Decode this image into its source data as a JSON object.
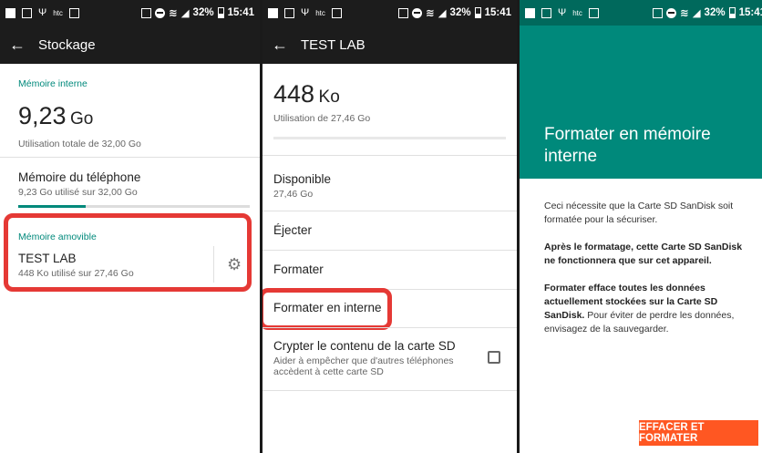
{
  "status_bar": {
    "left_icons": [
      "image-icon",
      "box-icon",
      "usb-icon",
      "htc-icon",
      "check-icon"
    ],
    "htc_label": "htc",
    "right_text": "32%",
    "time": "15:41"
  },
  "panel1": {
    "title": "Stockage",
    "internal_label": "Mémoire interne",
    "internal_value": "9,23",
    "internal_unit": "Go",
    "internal_total": "Utilisation totale de 32,00 Go",
    "phone_title": "Mémoire du téléphone",
    "phone_sub": "9,23 Go utilisé sur 32,00 Go",
    "phone_progress": 0.29,
    "removable_label": "Mémoire amovible",
    "sd_name": "TEST LAB",
    "sd_sub": "448 Ko utilisé sur 27,46 Go"
  },
  "panel2": {
    "title": "TEST LAB",
    "used_value": "448",
    "used_unit": "Ko",
    "used_sub": "Utilisation de 27,46 Go",
    "available_title": "Disponible",
    "available_value": "27,46 Go",
    "eject": "Éjecter",
    "format": "Formater",
    "format_internal": "Formater en interne",
    "encrypt_title": "Crypter le contenu de la carte SD",
    "encrypt_sub": "Aider à empêcher que d'autres téléphones accèdent à cette carte SD"
  },
  "panel3": {
    "header_title": "Formater en mémoire interne",
    "para1": "Ceci nécessite que la Carte SD SanDisk soit formatée pour la sécuriser.",
    "para2": "Après le formatage, cette Carte SD SanDisk ne fonctionnera que sur cet appareil.",
    "para3_bold": "Formater efface toutes les données actuellement stockées sur la Carte SD SanDisk.",
    "para3_rest": " Pour éviter de perdre les données, envisagez de la sauvegarder.",
    "button": "EFFACER ET FORMATER"
  },
  "colors": {
    "accent": "#00897b",
    "highlight": "#e53935",
    "button": "#ff5722",
    "header_green": "#00897b",
    "dark_bar": "#1c1c1c"
  }
}
